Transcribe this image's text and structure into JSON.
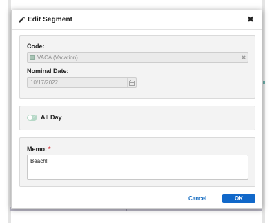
{
  "dialog": {
    "title": "Edit Segment",
    "title_icon": "pencil-icon",
    "close_icon": "close-icon",
    "close_glyph": "✖"
  },
  "details": {
    "code_label": "Code:",
    "code_value": "VACA (Vacation)",
    "code_color": "#a9c4b5",
    "code_clear_glyph": "✖",
    "nominal_date_label": "Nominal Date:",
    "nominal_date_value": "10/17/2022",
    "calendar_icon": "calendar-icon"
  },
  "all_day": {
    "label": "All Day",
    "checked": true,
    "check_glyph": "✓"
  },
  "memo": {
    "label": "Memo:",
    "required_mark": "*",
    "value": "Beach!"
  },
  "footer": {
    "cancel_label": "Cancel",
    "ok_label": "OK"
  },
  "colors": {
    "primary": "#1168c9",
    "link": "#1a6fc2",
    "required": "#d9262e",
    "toggle_on": "#b6d8c7"
  }
}
